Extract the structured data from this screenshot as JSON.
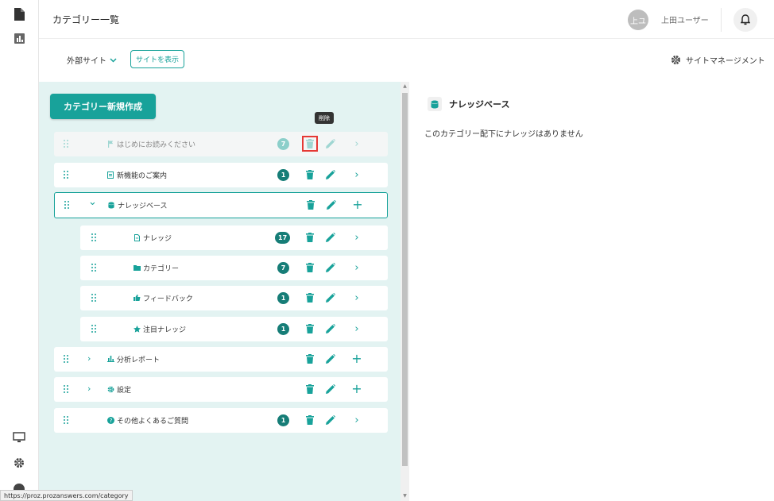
{
  "header": {
    "title": "カテゴリー一覧",
    "avatar_text": "上ユ",
    "username": "上田ユーザー"
  },
  "subheader": {
    "site_select": "外部サイト",
    "view_site_button": "サイトを表示",
    "site_management": "サイトマネージメント"
  },
  "left_panel": {
    "create_button": "カテゴリー新規作成",
    "tooltip": "削除",
    "rows": [
      {
        "label": "はじめにお読みください",
        "icon": "flag-icon",
        "badge": "7",
        "action": "chevron",
        "dim": true
      },
      {
        "label": "新機能のご案内",
        "icon": "document-icon",
        "badge": "1",
        "action": "chevron"
      },
      {
        "label": "ナレッジベース",
        "icon": "database-icon",
        "badge": "",
        "action": "plus",
        "expanded": true
      },
      {
        "label": "ナレッジ",
        "icon": "file-icon",
        "badge": "17",
        "action": "chevron",
        "child": true
      },
      {
        "label": "カテゴリー",
        "icon": "folder-icon",
        "badge": "7",
        "action": "chevron",
        "child": true
      },
      {
        "label": "フィードバック",
        "icon": "thumbs-up-icon",
        "badge": "1",
        "action": "chevron",
        "child": true
      },
      {
        "label": "注目ナレッジ",
        "icon": "star-icon",
        "badge": "1",
        "action": "chevron",
        "child": true
      },
      {
        "label": "分析レポート",
        "icon": "bar-chart-icon",
        "badge": "",
        "action": "plus",
        "collapsed": true
      },
      {
        "label": "設定",
        "icon": "gear-icon",
        "badge": "",
        "action": "plus",
        "collapsed": true
      },
      {
        "label": "その他よくあるご質問",
        "icon": "question-icon",
        "badge": "1",
        "action": "chevron"
      }
    ]
  },
  "right_panel": {
    "title": "ナレッジベース",
    "empty_message": "このカテゴリー配下にナレッジはありません"
  },
  "status_bar": {
    "url": "https://proz.prozanswers.com/category"
  },
  "colors": {
    "accent": "#18a29a",
    "panel_bg": "#e3f3f2",
    "highlight": "#e53935"
  }
}
